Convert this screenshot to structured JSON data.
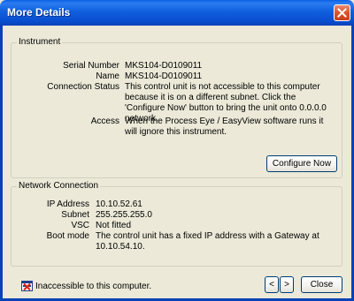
{
  "window": {
    "title": "More Details"
  },
  "instrument": {
    "legend": "Instrument",
    "fields": [
      {
        "label": "Serial Number",
        "value": "MKS104-D0109011"
      },
      {
        "label": "Name",
        "value": "MKS104-D0109011"
      },
      {
        "label": "Connection Status",
        "value": "This control unit is not accessible to this computer because it is on a different subnet.  Click the 'Configure Now' button to bring the unit onto 0.0.0.0 network."
      },
      {
        "label": "Access",
        "value": "When the Process Eye / EasyView software runs it will ignore this instrument."
      }
    ],
    "configure_label": "Configure Now"
  },
  "network": {
    "legend": "Network Connection",
    "fields": [
      {
        "label": "IP Address",
        "value": "10.10.52.61"
      },
      {
        "label": "Subnet",
        "value": "255.255.255.0"
      },
      {
        "label": "VSC",
        "value": "Not fitted"
      },
      {
        "label": "Boot mode",
        "value": "The control unit has a fixed IP address with a Gateway at 10.10.54.10."
      }
    ]
  },
  "footer": {
    "status_icon": "no-connection-icon",
    "status_text": "Inaccessible to this computer.",
    "prev_label": "<",
    "next_label": ">",
    "close_label": "Close"
  },
  "colors": {
    "titlebar": "#0a4fd1",
    "close_button": "#d9542b",
    "dialog_face": "#ece9d8",
    "group_border": "#d0d0bf"
  }
}
